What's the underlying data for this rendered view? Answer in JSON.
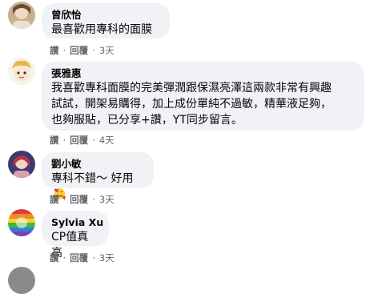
{
  "comments": [
    {
      "name": "曾欣怡",
      "lines": [
        "最喜歡用專科的面膜"
      ],
      "actions": {
        "like": "讚",
        "reply": "回覆",
        "time": "3天"
      }
    },
    {
      "name": "張雅惠",
      "lines": [
        "我喜歡專科面膜的完美彈潤跟保濕亮澤這兩款非常有興趣",
        "試試，開架易購得，加上成份單純不過敏，精華液足夠，",
        "也夠服貼，已分享+讚，YT同步留言。"
      ],
      "actions": {
        "like": "讚",
        "reply": "回覆",
        "time": "4天"
      }
    },
    {
      "name": "劉小敏",
      "lines": [
        "專科不錯～ 好用"
      ],
      "emoji": "smiling-face-with-hearts",
      "actions": {
        "like": "讚",
        "reply": "回覆",
        "time": "3天"
      }
    },
    {
      "name": "Sylvia Xu",
      "lines": [
        "CP值真高"
      ],
      "actions": {
        "like": "讚",
        "reply": "回覆",
        "time": "3天"
      }
    }
  ],
  "colors": {
    "bubble": "#f0f2f5",
    "meta": "#65676b",
    "text": "#050505"
  }
}
